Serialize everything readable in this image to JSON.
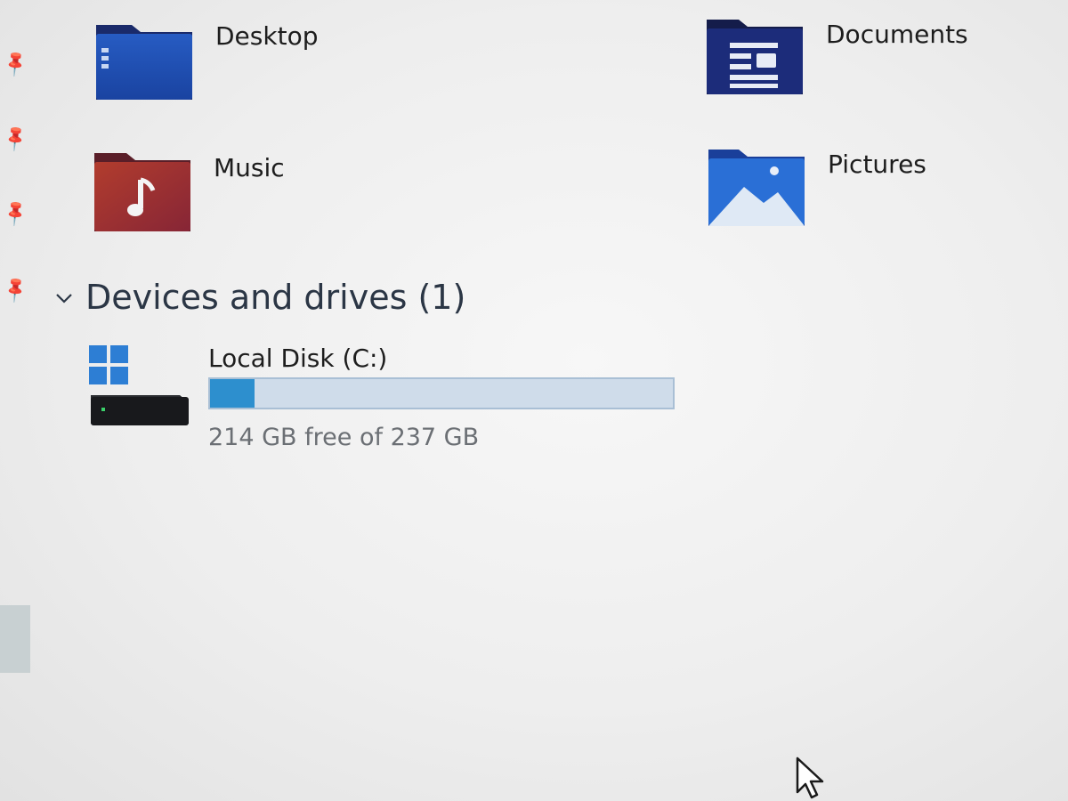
{
  "quick_access": {
    "folders": [
      {
        "label": "Desktop",
        "icon": "desktop-folder-icon"
      },
      {
        "label": "Documents",
        "icon": "documents-folder-icon"
      },
      {
        "label": "Music",
        "icon": "music-folder-icon"
      },
      {
        "label": "Pictures",
        "icon": "pictures-folder-icon"
      }
    ],
    "pin_icon": "pin-icon"
  },
  "devices": {
    "header": "Devices and drives (1)",
    "drives": [
      {
        "name": "Local Disk (C:)",
        "capacity_text": "214 GB free of 237 GB",
        "used_fraction": 0.097,
        "icon": "windows-drive-icon"
      }
    ]
  },
  "colors": {
    "usage_fill": "#2d8fce",
    "usage_track": "#cfdcea",
    "accent_blue": "#1f4fb4"
  }
}
